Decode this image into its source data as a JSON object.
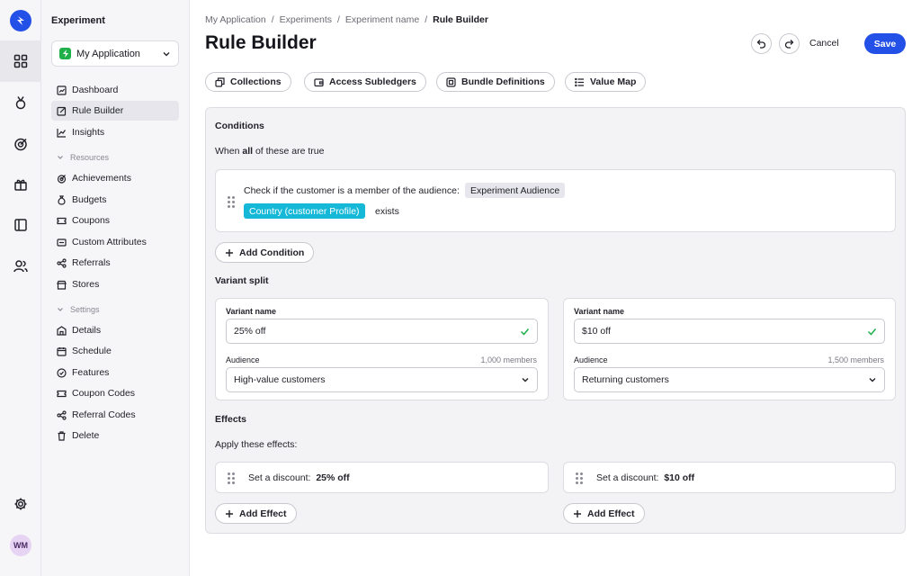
{
  "sidebar": {
    "title": "Experiment",
    "app_select": "My Application",
    "items": [
      {
        "label": "Dashboard"
      },
      {
        "label": "Rule Builder"
      },
      {
        "label": "Insights"
      }
    ],
    "resources_label": "Resources",
    "resources": [
      {
        "label": "Achievements"
      },
      {
        "label": "Budgets"
      },
      {
        "label": "Coupons"
      },
      {
        "label": "Custom Attributes"
      },
      {
        "label": "Referrals"
      },
      {
        "label": "Stores"
      }
    ],
    "settings_label": "Settings",
    "settings": [
      {
        "label": "Details"
      },
      {
        "label": "Schedule"
      },
      {
        "label": "Features"
      },
      {
        "label": "Coupon Codes"
      },
      {
        "label": "Referral Codes"
      },
      {
        "label": "Delete"
      }
    ]
  },
  "rail": {
    "avatar": "WM"
  },
  "breadcrumb": [
    "My Application",
    "Experiments",
    "Experiment name",
    "Rule Builder"
  ],
  "breadcrumb_sep": "/",
  "header": {
    "title": "Rule Builder",
    "cancel": "Cancel",
    "save": "Save"
  },
  "toolbar": [
    "Collections",
    "Access Subledgers",
    "Bundle Definitions",
    "Value Map"
  ],
  "conditions": {
    "heading": "Conditions",
    "when_prefix": "When",
    "when_bold": "all",
    "when_suffix": "of these are true",
    "rule_text": "Check if the customer is a member of the audience:",
    "audience_tag": "Experiment Audience",
    "attribute_tag": "Country (customer Profile)",
    "operator": "exists",
    "add_label": "Add Condition"
  },
  "variant_split": {
    "heading": "Variant split",
    "variants": [
      {
        "name_label": "Variant name",
        "name": "25% off",
        "audience_label": "Audience",
        "members": "1,000 members",
        "audience": "High-value customers"
      },
      {
        "name_label": "Variant name",
        "name": "$10 off",
        "audience_label": "Audience",
        "members": "1,500 members",
        "audience": "Returning customers"
      }
    ]
  },
  "effects": {
    "heading": "Effects",
    "subheading": "Apply these effects:",
    "items": [
      {
        "label": "Set a discount:",
        "value": "25% off",
        "add_label": "Add Effect"
      },
      {
        "label": "Set a discount:",
        "value": "$10 off",
        "add_label": "Add Effect"
      }
    ]
  },
  "colors": {
    "accent": "#2350e6",
    "cyan_tag": "#16b8d8",
    "check": "#1fb04a"
  }
}
